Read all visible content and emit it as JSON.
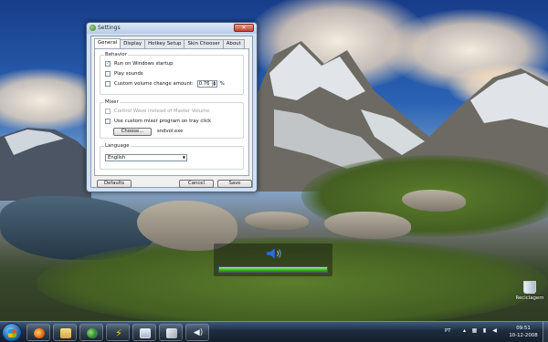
{
  "window": {
    "title": "Settings",
    "close_glyph": "✕",
    "tabs": [
      {
        "label": "General",
        "active": true
      },
      {
        "label": "Display",
        "active": false
      },
      {
        "label": "Hotkey Setup",
        "active": false
      },
      {
        "label": "Skin Chooser",
        "active": false
      },
      {
        "label": "About",
        "active": false
      }
    ],
    "behavior": {
      "title": "Behavior",
      "run_on_startup": {
        "label": "Run on Windows startup",
        "checked": true
      },
      "play_sounds": {
        "label": "Play sounds",
        "checked": false
      },
      "custom_volume": {
        "label": "Custom volume change amount:",
        "checked": false,
        "value": "0.76",
        "unit": "%"
      }
    },
    "mixer": {
      "title": "Mixer",
      "control_wave": {
        "label": "Control Wave instead of Master Volume",
        "checked": false,
        "enabled": false
      },
      "custom_mixer": {
        "label": "Use custom mixer program on tray click",
        "checked": false
      },
      "choose_label": "Choose...",
      "program": "sndvol.exe"
    },
    "language": {
      "title": "Language",
      "selected": "English"
    },
    "buttons": {
      "defaults": "Defaults",
      "cancel": "Cancel",
      "save": "Save"
    }
  },
  "osd": {
    "volume_level": 1.0,
    "icon": "speaker-icon"
  },
  "desktop": {
    "recycle_bin": "Reciclagem"
  },
  "taskbar": {
    "apps": [
      "firefox-icon",
      "explorer-icon",
      "messenger-icon",
      "lightning-icon",
      "window-icon",
      "sticky-icon",
      "volume-icon"
    ],
    "language": "PT",
    "time": "09:51",
    "date": "10-12-2008"
  },
  "colors": {
    "volume_bar": "#3dbb22",
    "taskbar": "#1d2c3e",
    "window_frame": "#cfe0f4"
  }
}
